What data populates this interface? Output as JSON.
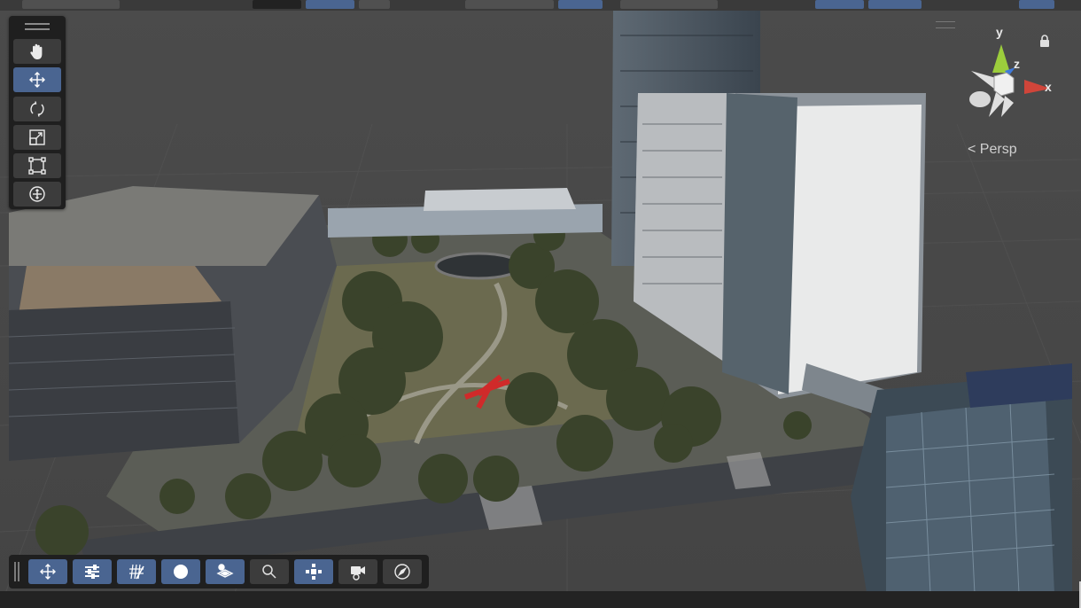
{
  "window": {
    "view_mode": "Persp"
  },
  "gizmo": {
    "axis_y": "y",
    "axis_z": "z",
    "axis_x": "x",
    "colors": {
      "x": "#d0453a",
      "y": "#9ccd3c",
      "z": "#3f7ad9",
      "neutral": "#e0e0e0"
    }
  },
  "tools": [
    {
      "name": "hand-tool",
      "icon": "hand-icon",
      "active": false
    },
    {
      "name": "move-tool",
      "icon": "move-icon",
      "active": true
    },
    {
      "name": "rotate-tool",
      "icon": "rotate-icon",
      "active": false
    },
    {
      "name": "scale-tool",
      "icon": "scale-icon",
      "active": false
    },
    {
      "name": "rect-tool",
      "icon": "rect-transform-icon",
      "active": false
    },
    {
      "name": "transform-tool",
      "icon": "transform-icon",
      "active": false
    }
  ],
  "overlay_tools": [
    {
      "name": "move-overlay",
      "icon": "move-arrows-icon",
      "active": true
    },
    {
      "name": "tool-settings",
      "icon": "sliders-icon",
      "active": true
    },
    {
      "name": "grid-snapping",
      "icon": "grid-icon",
      "active": true
    },
    {
      "name": "shading-mode",
      "icon": "sphere-icon",
      "active": true
    },
    {
      "name": "layers",
      "icon": "layers-icon",
      "active": true
    },
    {
      "name": "search",
      "icon": "search-icon",
      "active": false
    },
    {
      "name": "component-tools",
      "icon": "component-icon",
      "active": true
    },
    {
      "name": "camera",
      "icon": "camera-icon",
      "active": false
    },
    {
      "name": "orientation",
      "icon": "compass-icon",
      "active": false
    }
  ],
  "colors": {
    "accent": "#4a6591",
    "panel": "#1f1f1f",
    "button": "#3c3c3c",
    "sky": "#474747"
  }
}
